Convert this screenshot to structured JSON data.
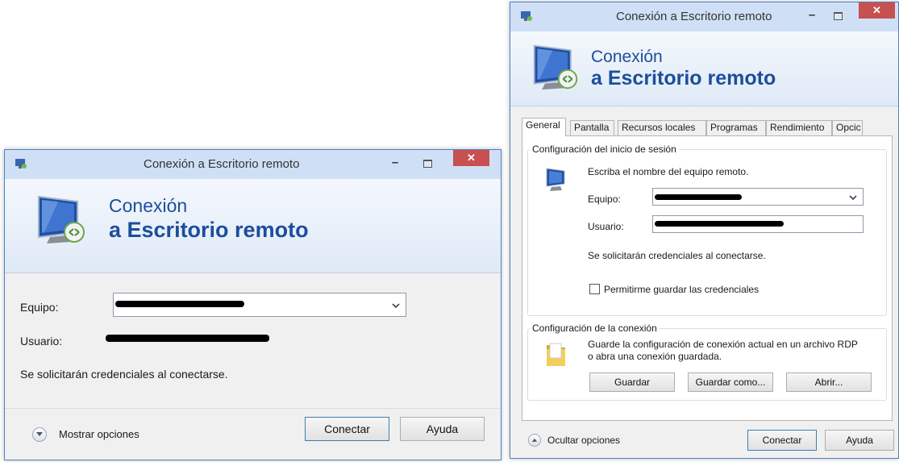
{
  "colors": {
    "accent": "#1c4e9c",
    "titlebar": "#cfe0f6",
    "close_button": "#c75050",
    "window_bg": "#f0f0f0"
  },
  "small_window": {
    "title": "Conexión a Escritorio remoto",
    "minimize_label": "–",
    "close_label": "✕",
    "banner": {
      "line1": "Conexión",
      "line2": "a Escritorio remoto",
      "icon": "monitor-remote-icon"
    },
    "equipo_label": "Equipo:",
    "usuario_label": "Usuario:",
    "credentials_note": "Se solicitarán credenciales al conectarse.",
    "show_options_label": "Mostrar opciones",
    "connect_label": "Conectar",
    "help_label": "Ayuda"
  },
  "large_window": {
    "title": "Conexión a Escritorio remoto",
    "minimize_label": "–",
    "close_label": "✕",
    "banner": {
      "line1": "Conexión",
      "line2": "a Escritorio remoto",
      "icon": "monitor-remote-icon"
    },
    "tabs": [
      "General",
      "Pantalla",
      "Recursos locales",
      "Programas",
      "Rendimiento",
      "Opcic"
    ],
    "active_tab": "General",
    "login_group": {
      "title": "Configuración del inicio de sesión",
      "hint": "Escriba el nombre del equipo remoto.",
      "equipo_label": "Equipo:",
      "usuario_label": "Usuario:",
      "credentials_note": "Se solicitarán credenciales al conectarse.",
      "save_credentials_label": "Permitirme guardar las credenciales",
      "save_credentials_checked": false
    },
    "connection_group": {
      "title": "Configuración de la conexión",
      "description": "Guarde la configuración de conexión actual en un archivo RDP o abra una conexión guardada.",
      "save_label": "Guardar",
      "save_as_label": "Guardar como...",
      "open_label": "Abrir..."
    },
    "hide_options_label": "Ocultar opciones",
    "connect_label": "Conectar",
    "help_label": "Ayuda"
  }
}
